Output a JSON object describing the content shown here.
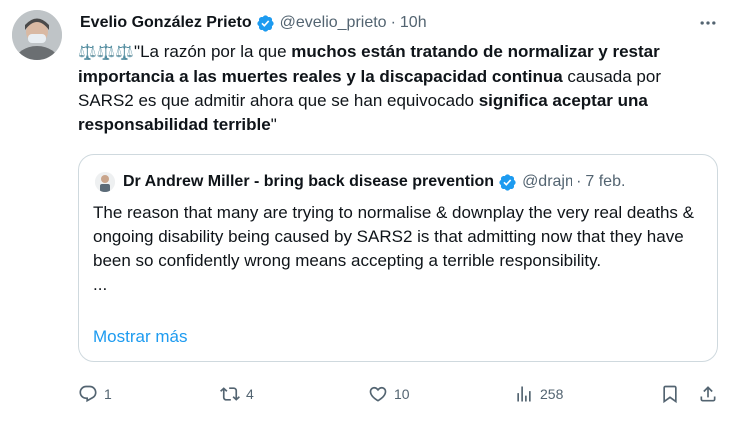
{
  "tweet": {
    "author_name": "Evelio González Prieto",
    "handle": "@evelio_prieto",
    "separator": "·",
    "time": "10h",
    "emoji": "⚖️⚖️⚖️",
    "text_parts": [
      "\"La razón por la que ",
      "muchos están tratando de normalizar y restar importancia a las muertes reales y la discapacidad continua",
      " causada por SARS2 es que admitir ahora que se han equivocado ",
      "significa aceptar una responsabilidad terrible",
      "\""
    ]
  },
  "quote": {
    "author_name": "Dr Andrew Miller - bring back disease prevention",
    "handle": "@drajm",
    "separator": "·",
    "time": "7 feb.",
    "text": "The reason that many are trying to normalise & downplay the very real deaths & ongoing disability being caused by SARS2 is that admitting now that they have been so confidently wrong means accepting a terrible responsibility.",
    "ellipsis": "...",
    "show_more": "Mostrar más"
  },
  "actions": {
    "replies": "1",
    "retweets": "4",
    "likes": "10",
    "views": "258"
  },
  "colors": {
    "verified_blue": "#1d9bf0",
    "secondary_text": "#536471",
    "link": "#1d9bf0",
    "border": "#cfd9de"
  },
  "icons": [
    "avatar",
    "verified-badge-icon",
    "more-icon",
    "reply-icon",
    "retweet-icon",
    "like-icon",
    "views-icon",
    "bookmark-icon",
    "share-icon"
  ]
}
